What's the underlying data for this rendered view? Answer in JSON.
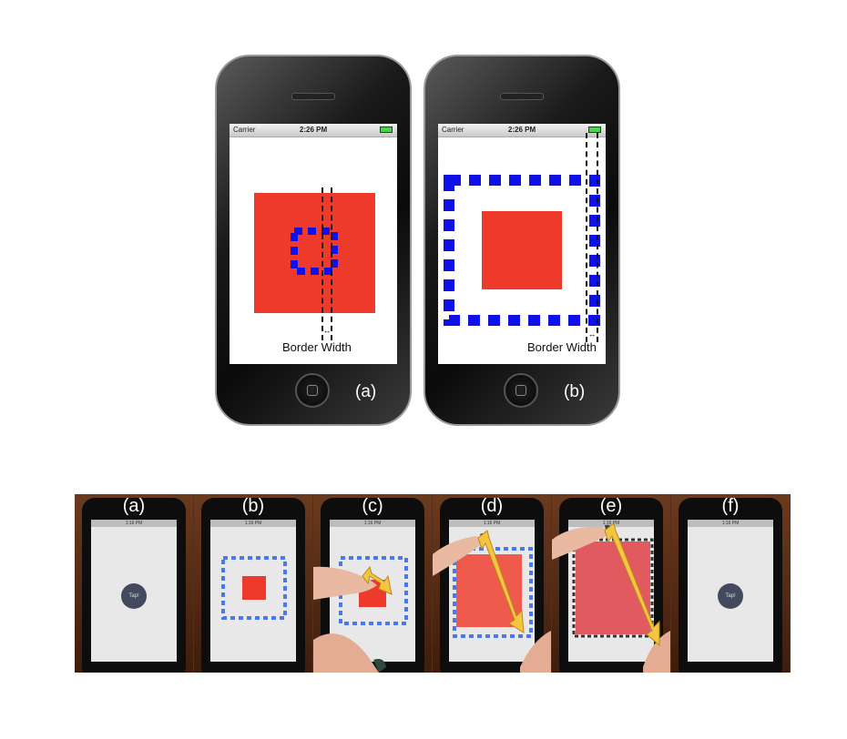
{
  "phones": [
    {
      "carrier": "Carrier",
      "time": "2:26 PM",
      "caption": "Border Width",
      "label": "(a)"
    },
    {
      "carrier": "Carrier",
      "time": "2:26 PM",
      "caption": "Border Width",
      "label": "(b)"
    }
  ],
  "frames": [
    {
      "label": "(a)",
      "status": "1:16 PM",
      "button": "Tap!"
    },
    {
      "label": "(b)",
      "status": "1:16 PM"
    },
    {
      "label": "(c)",
      "status": "1:16 PM"
    },
    {
      "label": "(d)",
      "status": "1:16 PM"
    },
    {
      "label": "(e)",
      "status": "1:16 PM"
    },
    {
      "label": "(f)",
      "status": "1:16 PM",
      "button": "Tap!"
    }
  ],
  "colors": {
    "red": "#ee3a2b",
    "blue": "#1010e8",
    "arrow": "#f5c542",
    "nail": "#2e4a3c"
  }
}
